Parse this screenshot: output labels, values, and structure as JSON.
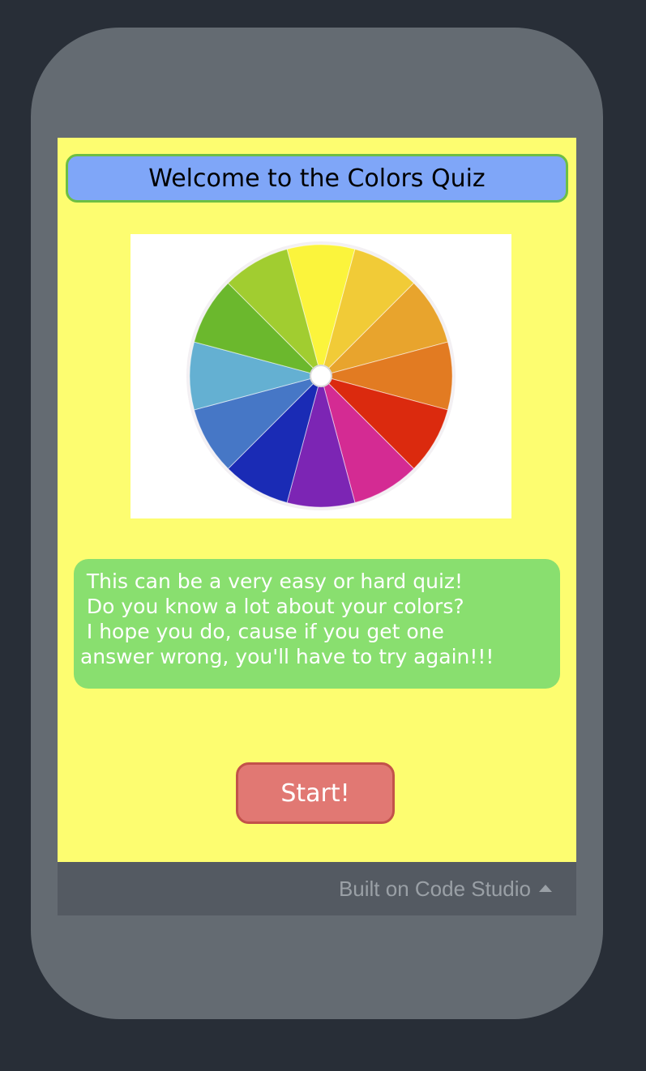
{
  "app": {
    "title": "Welcome to the Colors Quiz",
    "message_lines": [
      "  This can be a very easy or hard quiz!",
      "  Do you know a lot about your colors?",
      "  I hope you do, cause if you get one",
      " answer wrong, you'll have to try again!!!"
    ],
    "start_label": "Start!",
    "footer_label": "Built on Code Studio",
    "footer_icon": "caret-up-icon"
  },
  "colors": {
    "device_bezel": "#646b72",
    "background": "#282e37",
    "screen": "#fdfd70",
    "title_fill": "#7fa6f8",
    "title_border": "#6dbf43",
    "message_fill": "#89df6f",
    "button_fill": "#e17873",
    "button_border": "#c2524a"
  },
  "color_wheel": {
    "segments": [
      "#fbf43c",
      "#f1cb37",
      "#e8a42d",
      "#e27b22",
      "#db2a0e",
      "#d42b93",
      "#7c25b4",
      "#1a2bb5",
      "#4677c6",
      "#64b0d2",
      "#6bb82d",
      "#a1cd30"
    ]
  }
}
